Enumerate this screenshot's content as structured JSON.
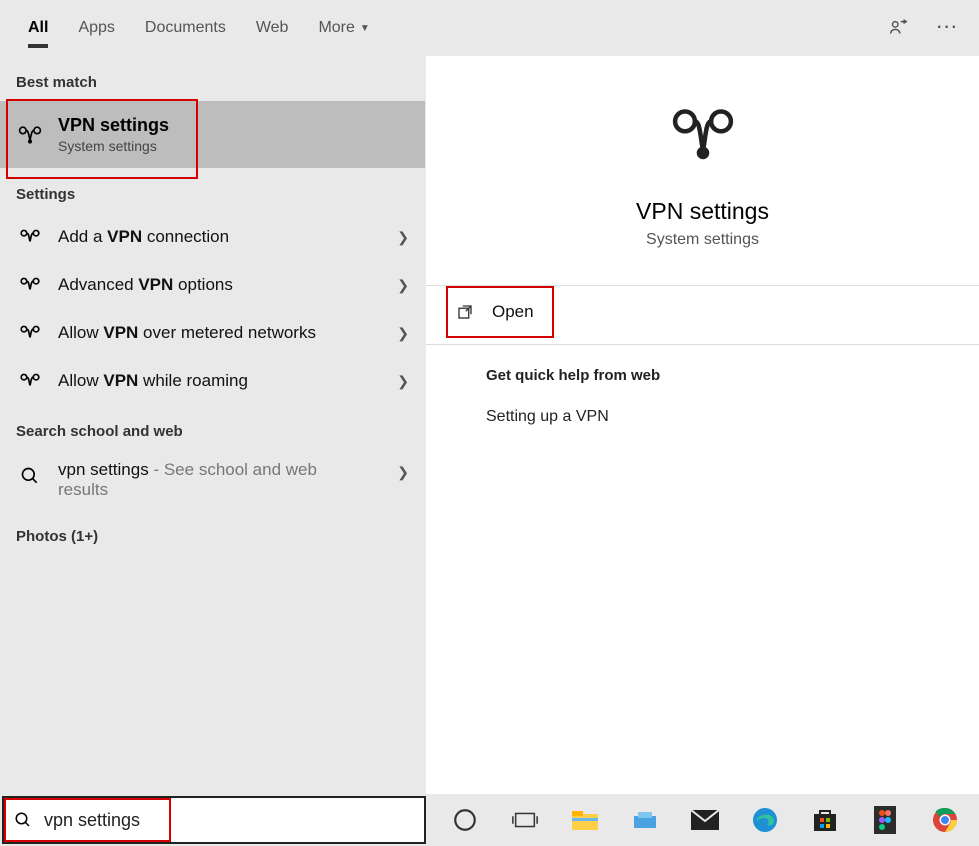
{
  "tabs": {
    "all": "All",
    "apps": "Apps",
    "documents": "Documents",
    "web": "Web",
    "more": "More"
  },
  "left": {
    "best_match_header": "Best match",
    "best": {
      "title": "VPN settings",
      "subtitle": "System settings"
    },
    "settings_header": "Settings",
    "row1_pre": "Add a ",
    "row1_b": "VPN",
    "row1_post": " connection",
    "row2_pre": "Advanced ",
    "row2_b": "VPN",
    "row2_post": " options",
    "row3_pre": "Allow ",
    "row3_b": "VPN",
    "row3_post": " over metered networks",
    "row4_pre": "Allow ",
    "row4_b": "VPN",
    "row4_post": " while roaming",
    "web_header": "Search school and web",
    "web_main": "vpn settings",
    "web_sub": " - See school and web results",
    "photos_header": "Photos (1+)"
  },
  "right": {
    "title": "VPN settings",
    "subtitle": "System settings",
    "open": "Open",
    "quick_help_header": "Get quick help from web",
    "quick_link": "Setting up a VPN"
  },
  "taskbar": {
    "search_value": "vpn settings"
  }
}
